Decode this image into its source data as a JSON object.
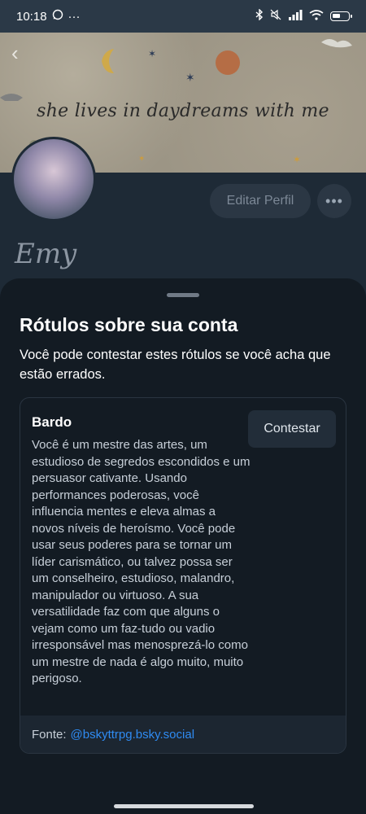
{
  "status_bar": {
    "time": "10:18",
    "whatsapp_icon": "whatsapp-icon",
    "more": "···"
  },
  "banner": {
    "text": "she lives in daydreams with me"
  },
  "profile": {
    "edit_label": "Editar Perfil",
    "more_label": "•••",
    "name": "Emy"
  },
  "sheet": {
    "title": "Rótulos sobre sua conta",
    "subtitle": "Você pode contestar estes rótulos se você acha que estão errados.",
    "label_card": {
      "name": "Bardo",
      "description": "Você é um mestre das artes, um estudioso de segredos escondidos e um persuasor cativante. Usando performances poderosas, você influencia mentes e eleva almas a novos níveis de heroísmo. Você pode usar seus poderes para se tornar um líder carismático, ou talvez possa ser um conselheiro, estudioso, malandro, manipulador ou virtuoso. A sua versatilidade faz com que alguns o vejam como um faz-tudo ou vadio irresponsável mas menosprezá-lo como um mestre de nada é algo muito, muito perigoso.",
      "contest_label": "Contestar",
      "source_prefix": "Fonte:",
      "source_handle": "@bskyttrpg.bsky.social"
    }
  },
  "colors": {
    "accent_link": "#2f8bf2",
    "sheet_bg": "#131b23",
    "page_bg": "#1e2a36"
  }
}
